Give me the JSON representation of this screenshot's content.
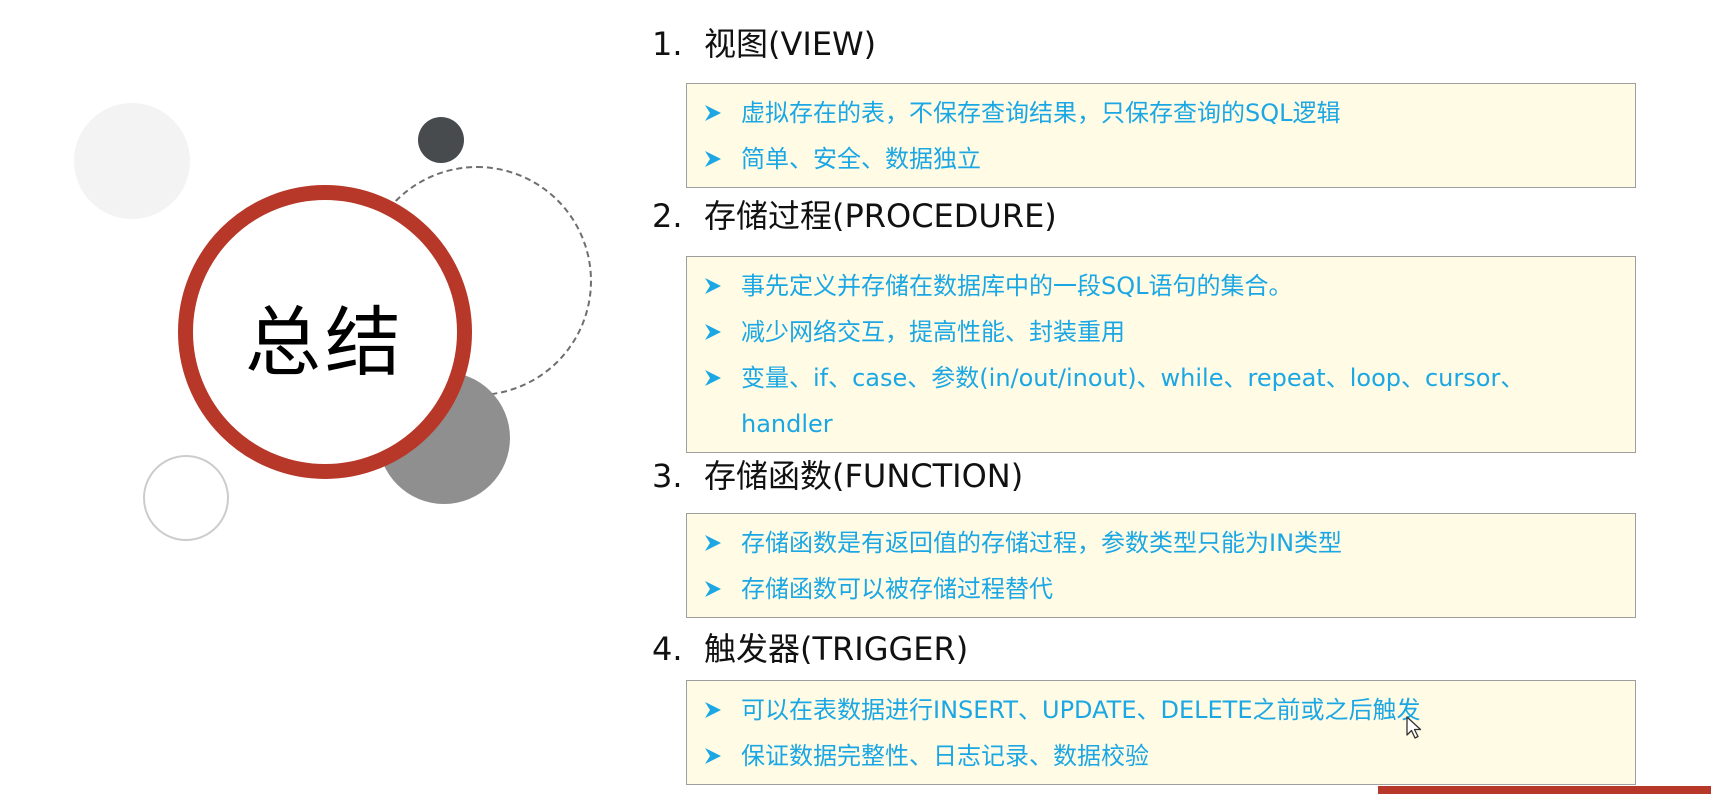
{
  "slide_title": "总结",
  "accent_color": "#b73728",
  "bullet_text_color": "#1ba7e4",
  "bullet_icon": "arrow-bullet-icon",
  "sections": [
    {
      "number": "1.",
      "title": "视图(VIEW)",
      "bullets": [
        "虚拟存在的表，不保存查询结果，只保存查询的SQL逻辑",
        "简单、安全、数据独立"
      ]
    },
    {
      "number": "2.",
      "title": "存储过程(PROCEDURE)",
      "bullets": [
        "事先定义并存储在数据库中的一段SQL语句的集合。",
        "减少网络交互，提高性能、封装重用",
        "变量、if、case、参数(in/out/inout)、while、repeat、loop、cursor、handler"
      ]
    },
    {
      "number": "3.",
      "title": "存储函数(FUNCTION)",
      "bullets": [
        "存储函数是有返回值的存储过程，参数类型只能为IN类型",
        "存储函数可以被存储过程替代"
      ]
    },
    {
      "number": "4.",
      "title": "触发器(TRIGGER)",
      "bullets": [
        "可以在表数据进行INSERT、UPDATE、DELETE之前或之后触发",
        "保证数据完整性、日志记录、数据校验"
      ]
    }
  ]
}
